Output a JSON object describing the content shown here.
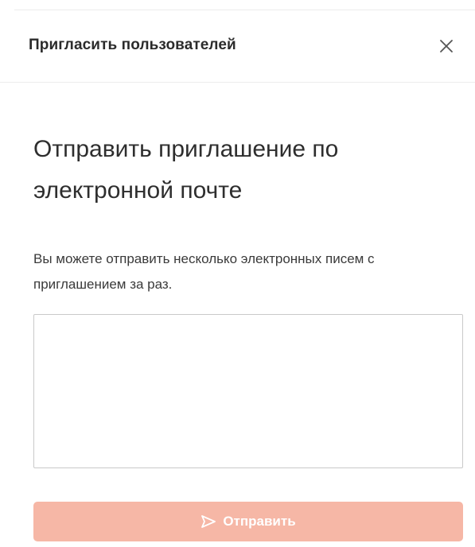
{
  "dialog": {
    "title": "Пригласить пользователей",
    "close_icon": "close-icon"
  },
  "content": {
    "heading": "Отправить приглашение по электронной почте",
    "description": "Вы можете отправить несколько электронных писем с приглашением за раз.",
    "email_input_value": "",
    "send_button_label": "Отправить",
    "send_icon": "send-icon"
  },
  "colors": {
    "button_bg": "#f6b7a6",
    "button_text": "#ffffff",
    "text_primary": "#2e2e2e",
    "border": "#c9c9c9"
  }
}
